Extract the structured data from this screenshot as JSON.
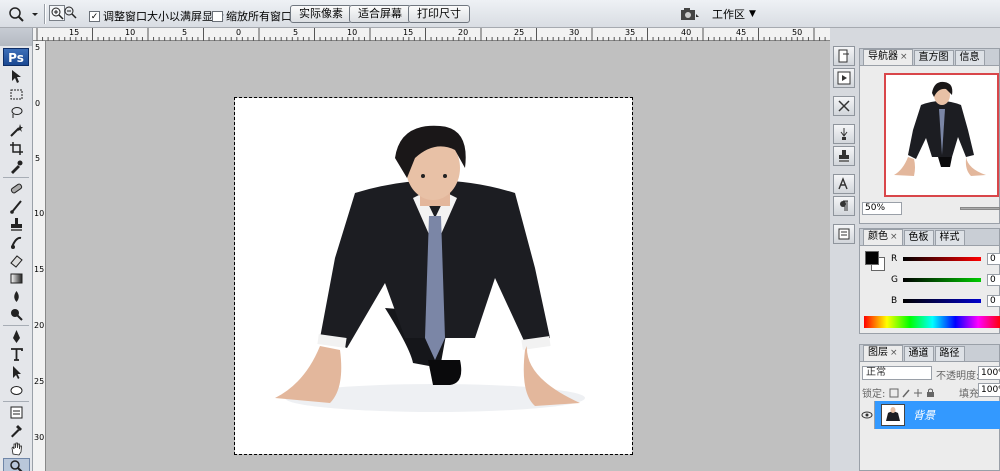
{
  "options_bar": {
    "fit_window_label": "调整窗口大小以满屏显示",
    "fit_window_checked": true,
    "zoom_all_windows_label": "缩放所有窗口",
    "zoom_all_windows_checked": false,
    "actual_pixels_label": "实际像素",
    "fit_screen_label": "适合屏幕",
    "print_size_label": "打印尺寸",
    "workspace_label": "工作区",
    "workspace_arrow": "▼",
    "checkmark": "✓"
  },
  "toolbox": {
    "logo": "Ps",
    "tools": [
      "move-tool",
      "marquee-tool",
      "lasso-tool",
      "quick-select-tool",
      "crop-tool",
      "slice-tool",
      "healing-brush-tool",
      "brush-tool",
      "clone-stamp-tool",
      "history-brush-tool",
      "eraser-tool",
      "gradient-tool",
      "blur-tool",
      "dodge-tool",
      "pen-tool",
      "type-tool",
      "path-select-tool",
      "shape-tool",
      "notes-tool",
      "eyedropper-tool",
      "hand-tool",
      "zoom-tool"
    ]
  },
  "rulers": {
    "horizontal": [
      "15",
      "10",
      "5",
      "0",
      "5",
      "10",
      "15",
      "20",
      "25",
      "30",
      "35",
      "40",
      "45",
      "50"
    ],
    "vertical": [
      "5",
      "0",
      "5",
      "10",
      "15",
      "20",
      "25",
      "30"
    ]
  },
  "panels": {
    "navigator": {
      "tabs": [
        {
          "label": "导航器",
          "active": true
        },
        {
          "label": "直方图",
          "active": false
        },
        {
          "label": "信息",
          "active": false
        }
      ],
      "close_glyph": "×",
      "zoom": "50%"
    },
    "color": {
      "tabs": [
        {
          "label": "颜色",
          "active": true
        },
        {
          "label": "色板",
          "active": false
        },
        {
          "label": "样式",
          "active": false
        }
      ],
      "channels": [
        {
          "label": "R",
          "value": "0",
          "color": "#cc0000"
        },
        {
          "label": "G",
          "value": "0",
          "color": "#00aa00"
        },
        {
          "label": "B",
          "value": "0",
          "color": "#0000cc"
        }
      ],
      "foreground": "#000000",
      "background": "#ffffff"
    },
    "layers": {
      "tabs": [
        {
          "label": "图层",
          "active": true
        },
        {
          "label": "通道",
          "active": false
        },
        {
          "label": "路径",
          "active": false
        }
      ],
      "blend_mode": "正常",
      "opacity_label": "不透明度:",
      "opacity_value": "100%",
      "lock_label": "锁定:",
      "fill_label": "填充:",
      "fill_value": "100%",
      "layer_name": "背景",
      "selected_color": "#3399ff"
    }
  }
}
